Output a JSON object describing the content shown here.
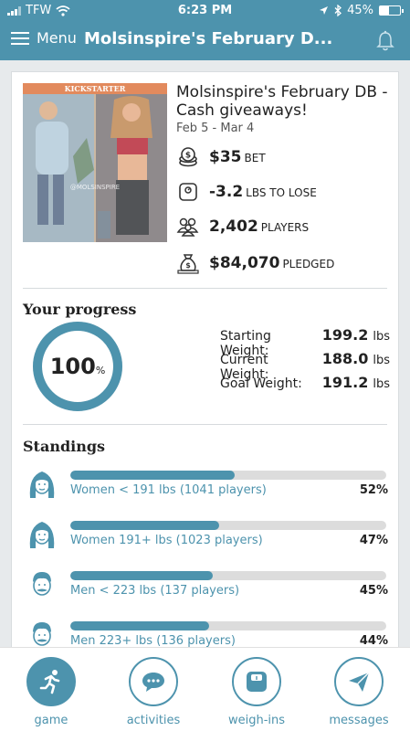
{
  "status_bar": {
    "carrier": "TFW",
    "time": "6:23 PM",
    "battery": "45%",
    "battery_level": 0.45
  },
  "header": {
    "menu_label": "Menu",
    "title": "Molsinspire's February D..."
  },
  "game": {
    "image_banner": "KICKSTARTER",
    "image_watermark": "@MOLSINSPIRE",
    "title": "Molsinspire's February DB - Cash giveaways!",
    "dates": "Feb 5 - Mar 4",
    "stats": [
      {
        "value": "$35",
        "unit": "BET",
        "icon": "coins-icon"
      },
      {
        "value": "-3.2",
        "unit": "LBS TO LOSE",
        "icon": "scale-icon"
      },
      {
        "value": "2,402",
        "unit": "PLAYERS",
        "icon": "players-icon"
      },
      {
        "value": "$84,070",
        "unit": "PLEDGED",
        "icon": "money-bag-icon"
      }
    ]
  },
  "progress": {
    "heading": "Your progress",
    "percent_value": "100",
    "percent_sign": "%",
    "percent_fraction": 1.0,
    "weights": [
      {
        "label": "Starting Weight:",
        "value": "199.2",
        "unit": "lbs"
      },
      {
        "label": "Current Weight:",
        "value": "188.0",
        "unit": "lbs"
      },
      {
        "label": "Goal Weight:",
        "value": "191.2",
        "unit": "lbs"
      }
    ]
  },
  "standings": {
    "heading": "Standings",
    "rows": [
      {
        "label": "Women < 191 lbs (1041 players)",
        "percent": "52%",
        "fraction": 0.52,
        "icon": "woman-avatar-icon"
      },
      {
        "label": "Women 191+ lbs (1023 players)",
        "percent": "47%",
        "fraction": 0.47,
        "icon": "woman-avatar-icon"
      },
      {
        "label": "Men < 223 lbs (137 players)",
        "percent": "45%",
        "fraction": 0.45,
        "icon": "man-avatar-icon"
      },
      {
        "label": "Men 223+ lbs (136 players)",
        "percent": "44%",
        "fraction": 0.44,
        "icon": "man-avatar-icon"
      }
    ]
  },
  "tabs": [
    {
      "label": "game",
      "icon": "runner-icon",
      "active": true
    },
    {
      "label": "activities",
      "icon": "chat-icon",
      "active": false
    },
    {
      "label": "weigh-ins",
      "icon": "scale-icon",
      "active": false
    },
    {
      "label": "messages",
      "icon": "paper-plane-icon",
      "active": false
    }
  ],
  "colors": {
    "accent": "#4d93ad",
    "track": "#dcdcdc"
  }
}
